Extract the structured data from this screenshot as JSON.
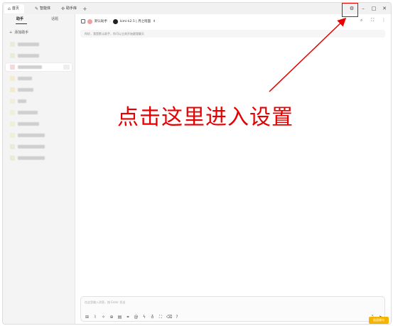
{
  "titlebar": {
    "tabs": [
      {
        "icon": "home-icon",
        "glyph": "⌂",
        "label": "首页"
      },
      {
        "icon": "sparkle-icon",
        "glyph": "✎",
        "label": "智能体"
      },
      {
        "icon": "plugin-icon",
        "glyph": "✣",
        "label": "助手库"
      }
    ],
    "add": "+",
    "controls": {
      "settings": "⚙",
      "minimize": "–",
      "maximize": "□",
      "close": "✕"
    }
  },
  "sidebar": {
    "tabs": [
      "助手",
      "话题"
    ],
    "add_label": "添加助手",
    "items": [
      {
        "color": "#e9ecd6",
        "w": 30
      },
      {
        "color": "#e7eed8",
        "w": 30
      },
      {
        "color": "#f3d9dc",
        "w": 34
      },
      {
        "color": "#f4ecd0",
        "w": 20
      },
      {
        "color": "#f3e9cf",
        "w": 22
      },
      {
        "color": "#eeeedd",
        "w": 12
      },
      {
        "color": "#eef0d8",
        "w": 28
      },
      {
        "color": "#eef0d6",
        "w": 30
      },
      {
        "color": "#eef0d6",
        "w": 38
      },
      {
        "color": "#e6edd6",
        "w": 38
      },
      {
        "color": "#e6edd6",
        "w": 38
      }
    ]
  },
  "header": {
    "assistant": "默认助手",
    "model": "kimi-k2.5 | 月之暗面",
    "dropdown": "⇕"
  },
  "main": {
    "prompt": "你好，我是默认助手，你可以立刻开始跟我聊天"
  },
  "input": {
    "placeholder": "在这里输入消息，按 Enter 发送"
  },
  "watermark": "极速蜂鸟",
  "annotation": {
    "text": "点击这里进入设置",
    "color": "#e60000"
  }
}
